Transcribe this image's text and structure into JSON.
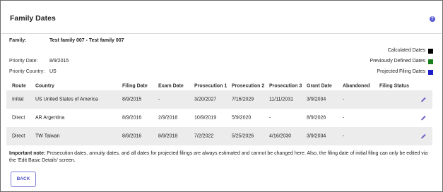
{
  "page": {
    "title": "Family Dates"
  },
  "family": {
    "label": "Family:",
    "value": "Test family 007 - Test family 007",
    "priority_date_label": "Priority Date:",
    "priority_date": "8/9/2015",
    "priority_country_label": "Priority Country:",
    "priority_country": "US"
  },
  "legend": [
    {
      "label": "Calculated Dates",
      "color": "#000000"
    },
    {
      "label": "Previously Defined Dates",
      "color": "#1a7f1a"
    },
    {
      "label": "Projected Filing Dates",
      "color": "#1c1cc8"
    }
  ],
  "table": {
    "headers": [
      "Route",
      "Country",
      "Filing Date",
      "Exam Date",
      "Prosecution 1",
      "Prosecution 2",
      "Prosecution 3",
      "Grant Date",
      "Abandoned",
      "Filing Status"
    ],
    "rows": [
      [
        "Initial",
        "US United States of America",
        "8/9/2015",
        "-",
        "3/20/2027",
        "7/16/2029",
        "11/11/2031",
        "3/9/2034",
        "-",
        ""
      ],
      [
        "Direct",
        "AR Argentina",
        "8/9/2016",
        "2/9/2018",
        "10/9/2019",
        "5/9/2020",
        "-",
        "8/9/2026",
        "-",
        ""
      ],
      [
        "Direct",
        "TW Taiwan",
        "8/9/2016",
        "8/9/2018",
        "7/2/2022",
        "5/25/2026",
        "4/16/2030",
        "3/9/2034",
        "-",
        ""
      ]
    ]
  },
  "note": {
    "label": "Important note:",
    "text": " Prosecution dates, annuity dates, and all dates for projected filings are always estimated and cannot be changed here. Also, the filing date of initial filing can only be edited via the 'Edit Basic Details' screen."
  },
  "actions": {
    "back_label": "BACK"
  },
  "icons": {
    "help": "help-icon",
    "edit": "pencil-icon"
  }
}
